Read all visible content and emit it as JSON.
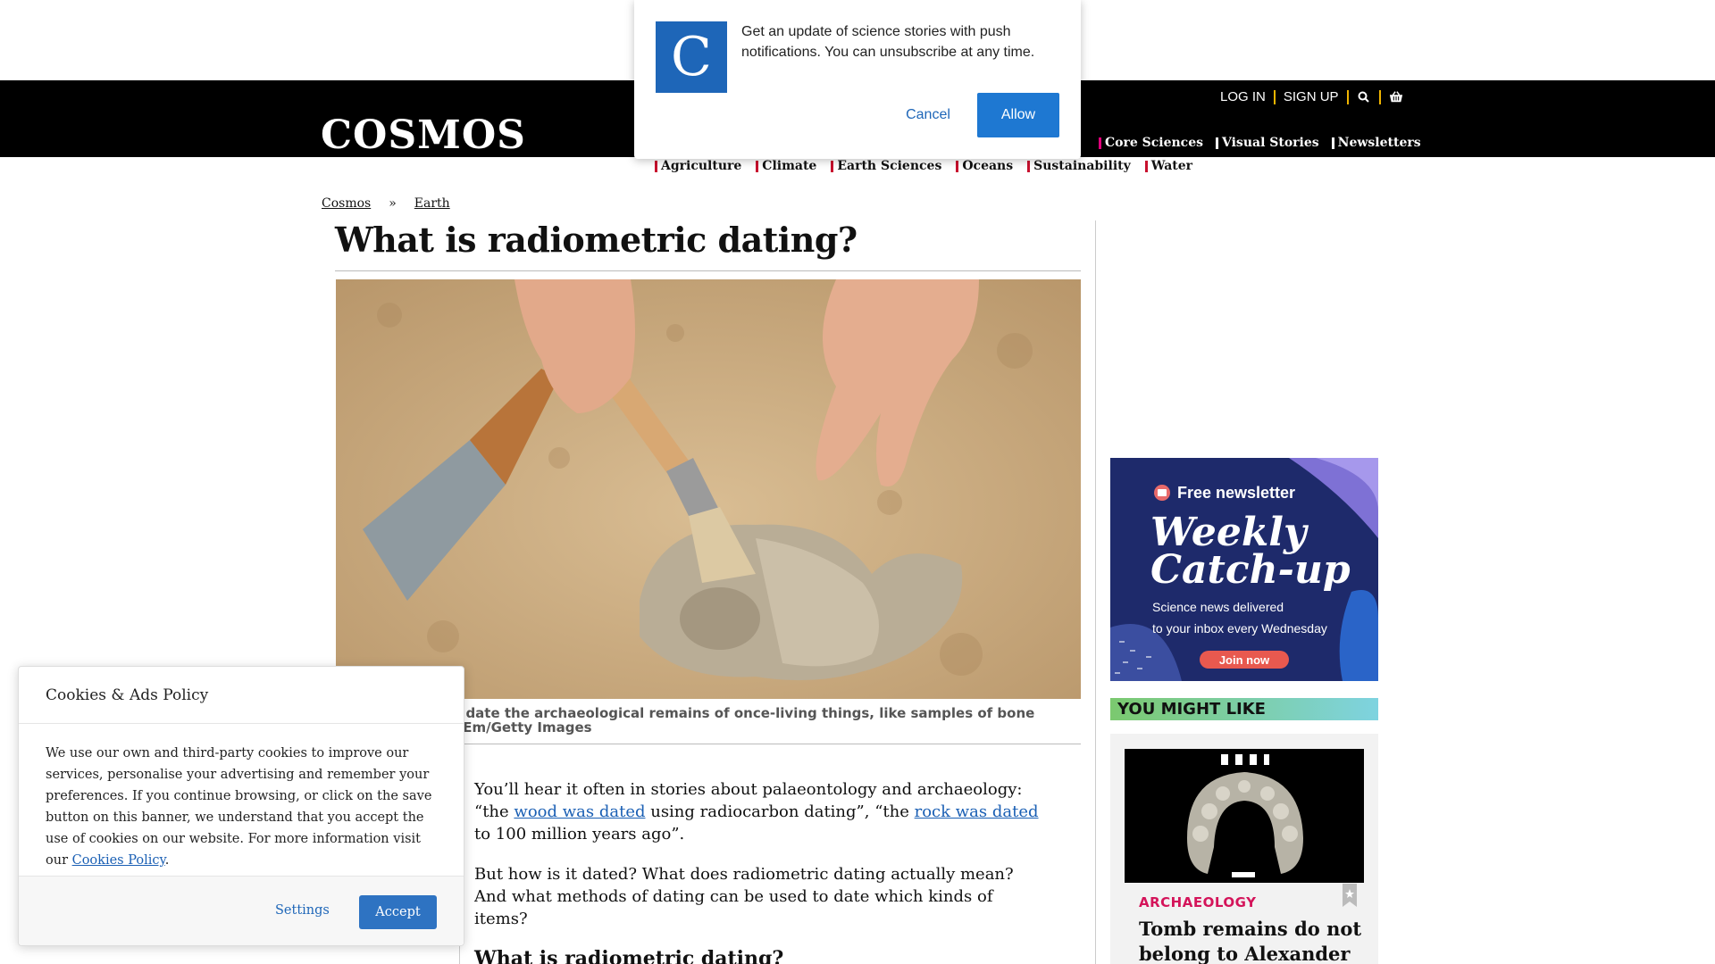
{
  "site": {
    "logo": "COSMOS",
    "util": {
      "login": "LOG IN",
      "signup": "SIGN UP"
    },
    "main_nav": [
      "Core Sciences",
      "Visual Stories",
      "Newsletters"
    ],
    "sub_nav": [
      "Agriculture",
      "Climate",
      "Earth Sciences",
      "Oceans",
      "Sustainability",
      "Water"
    ],
    "colors": {
      "header_bg": "#000000",
      "nav_accent": "#e0007a",
      "subnav_accent": "#c8102e",
      "util_separator": "#f0b400",
      "link": "#1a5fb4"
    }
  },
  "breadcrumb": {
    "home": "Cosmos",
    "separator": "»",
    "section": "Earth"
  },
  "article": {
    "title": "What is radiometric dating?",
    "caption_line1": "g can be used to date the archaeological remains of once-living things, like samples of bone",
    "caption_line2": "ćevica Mrdja/EyeEm/Getty Images",
    "p1_before": "You’ll hear it often in stories about palaeontology and archaeology: “the ",
    "p1_link1": "wood was dated",
    "p1_mid": " using radiocarbon dating”, “the ",
    "p1_link2": "rock was dated",
    "p1_after": " to 100 million years ago”.",
    "p2": "But how is it dated? What does radiometric dating actually mean? And what methods of dating can be used to date which kinds of items?",
    "h2": "What is radiometric dating?"
  },
  "sidebar": {
    "newsletter": {
      "tag": "Free newsletter",
      "headline1": "Weekly",
      "headline2": "Catch-up",
      "sub1": "Science news delivered",
      "sub2": "to your inbox every Wednesday",
      "cta": "Join now"
    },
    "you_might_like": "YOU MIGHT LIKE",
    "card": {
      "category": "ARCHAEOLOGY",
      "title": "Tomb remains do not belong to Alexander"
    }
  },
  "push_popup": {
    "logo_letter": "C",
    "text": "Get an update of science stories with push notifications. You can unsubscribe at any time.",
    "cancel": "Cancel",
    "allow": "Allow"
  },
  "cookie_banner": {
    "title": "Cookies & Ads Policy",
    "text": "We use our own and third-party cookies to improve our services, personalise your advertising and remember your preferences. If you continue browsing, or click on the save button on this banner, we understand that you accept the use of cookies on our website. For more information visit our ",
    "link": "Cookies Policy",
    "text_end": ".",
    "settings": "Settings",
    "accept": "Accept"
  }
}
